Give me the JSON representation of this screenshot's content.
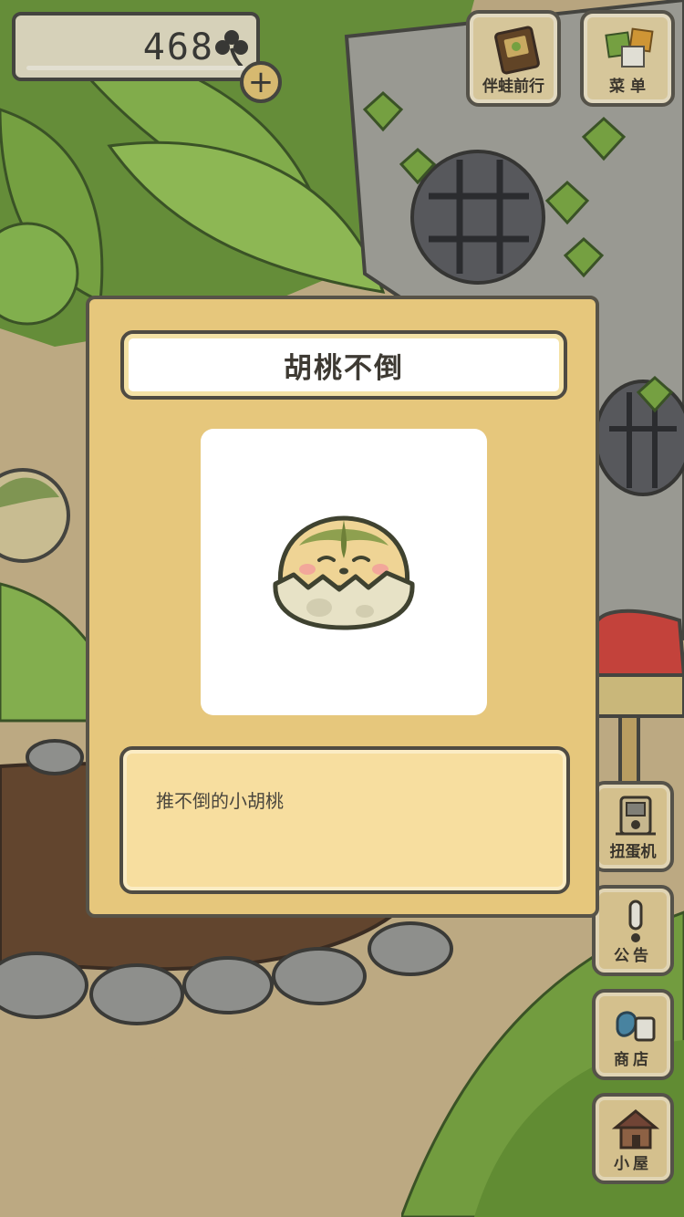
{
  "hud": {
    "clover_count": "468",
    "clover_icon": "clover-icon",
    "add_label": "+"
  },
  "top_buttons": [
    {
      "label": "伴蛙前行",
      "icon": "album-icon"
    },
    {
      "label": "菜 单",
      "icon": "menu-cards-icon"
    }
  ],
  "side_buttons": [
    {
      "label": "扭蛋机",
      "icon": "gacha-machine-icon"
    },
    {
      "label": "公告",
      "icon": "exclamation-icon"
    },
    {
      "label": "商店",
      "icon": "shop-bag-icon"
    },
    {
      "label": "小屋",
      "icon": "house-icon"
    }
  ],
  "popup": {
    "title": "胡桃不倒",
    "image_icon": "walnut-chick-icon",
    "description": "推不倒的小胡桃"
  },
  "colors": {
    "card_bg": "#e6c77c",
    "desc_bg": "#f7de9f",
    "outline": "#575348"
  }
}
